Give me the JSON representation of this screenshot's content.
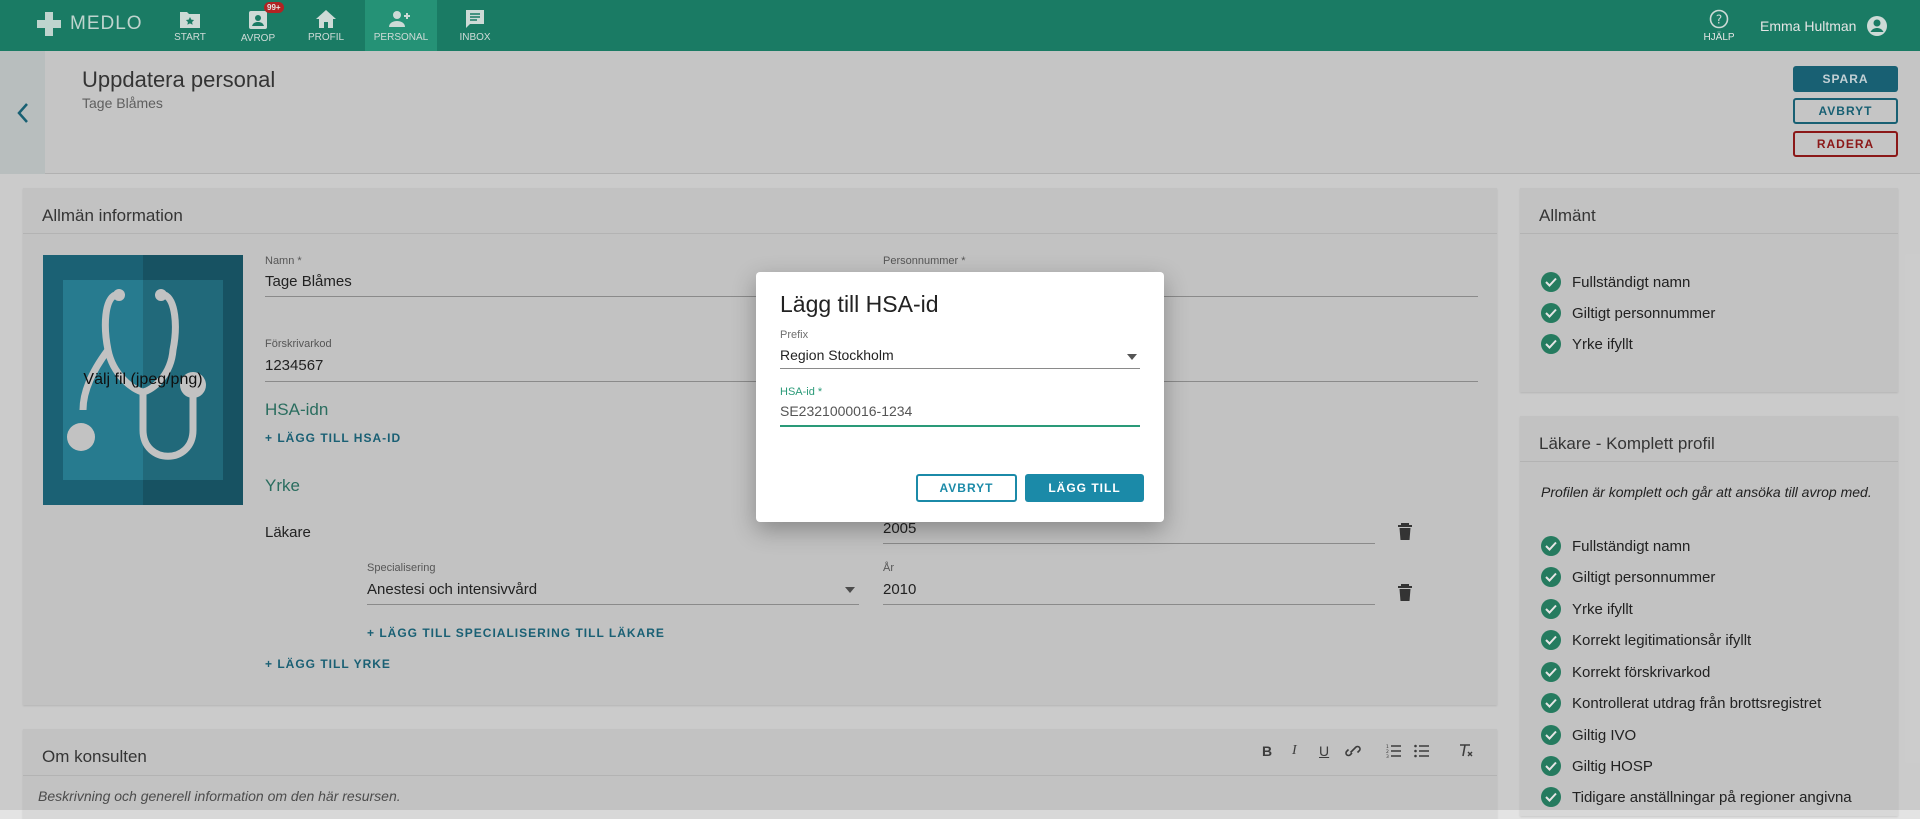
{
  "nav": {
    "brand": "MEDLO",
    "items": [
      {
        "label": "START",
        "icon": "star-folder-icon"
      },
      {
        "label": "AVROP",
        "icon": "badge-icon",
        "badge": "99+"
      },
      {
        "label": "PROFIL",
        "icon": "home-icon"
      },
      {
        "label": "PERSONAL",
        "icon": "people-icon",
        "active": true
      },
      {
        "label": "INBOX",
        "icon": "inbox-icon"
      }
    ],
    "help": "HJÄLP",
    "user": "Emma Hultman"
  },
  "header": {
    "title": "Uppdatera personal",
    "subtitle": "Tage Blåmes",
    "buttons": {
      "save": "SPARA",
      "cancel": "AVBRYT",
      "delete": "RADERA"
    }
  },
  "general": {
    "title": "Allmän information",
    "photo_text": "Välj fil (jpeg/png)",
    "name_label": "Namn *",
    "name_value": "Tage Blåmes",
    "pnr_label": "Personnummer *",
    "presc_label": "Förskrivarkod",
    "presc_value": "1234567",
    "hsa_title": "HSA-idn",
    "add_hsa": "+ LÄGG TILL HSA-ID",
    "yrke_title": "Yrke",
    "profession": "Läkare",
    "profession_year": "2005",
    "spec_label": "Specialisering",
    "spec_value": "Anestesi och intensivvård",
    "spec_year_label": "År",
    "spec_year": "2010",
    "add_spec": "+ LÄGG TILL SPECIALISERING TILL LÄKARE",
    "add_yrke": "+ LÄGG TILL YRKE"
  },
  "about": {
    "title": "Om konsulten",
    "placeholder": "Beskrivning och generell information om den här resursen.",
    "toolbar": [
      "B",
      "I",
      "U",
      "link-icon",
      "ordered-list-icon",
      "bullet-list-icon",
      "clear-format-icon"
    ]
  },
  "allmant": {
    "title": "Allmänt",
    "items": [
      "Fullständigt namn",
      "Giltigt personnummer",
      "Yrke ifyllt"
    ]
  },
  "lakare": {
    "title": "Läkare - Komplett profil",
    "description": "Profilen är komplett och går att ansöka till avrop med.",
    "items": [
      "Fullständigt namn",
      "Giltigt personnummer",
      "Yrke ifyllt",
      "Korrekt legitimationsår ifyllt",
      "Korrekt förskrivarkod",
      "Kontrollerat utdrag från brottsregistret",
      "Giltig IVO",
      "Giltig HOSP",
      "Tidigare anställningar på regioner angivna"
    ]
  },
  "dialog": {
    "title": "Lägg till HSA-id",
    "prefix_label": "Prefix",
    "prefix_value": "Region Stockholm",
    "hsa_label": "HSA-id *",
    "hsa_value": "SE2321000016-1234",
    "cancel": "AVBRYT",
    "add": "LÄGG TILL"
  },
  "colors": {
    "nav": "#1d8a70",
    "accent": "#1b6b80",
    "danger": "#9b1b1b",
    "check": "#2a8a6a"
  }
}
